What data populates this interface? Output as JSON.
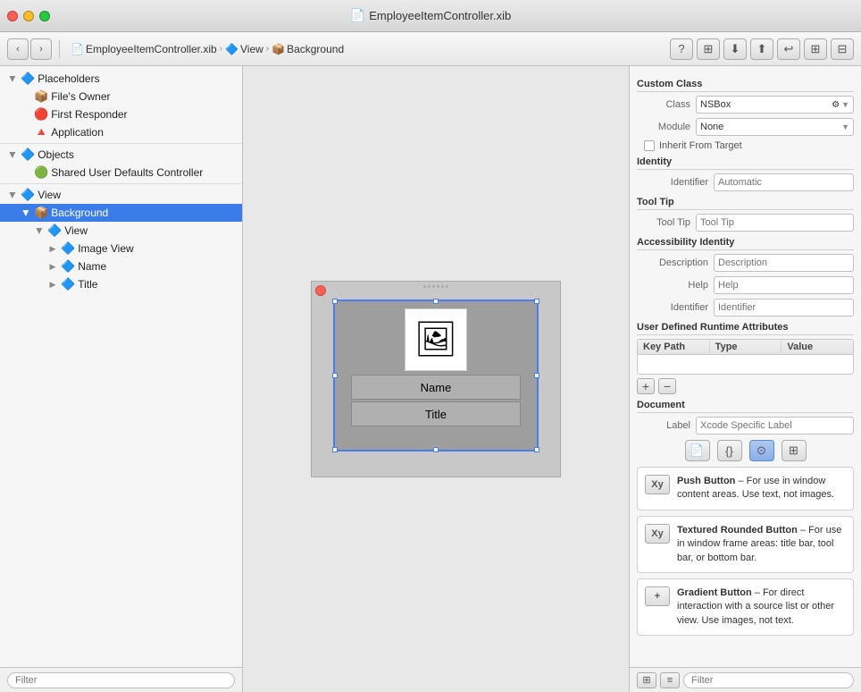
{
  "titleBar": {
    "title": "EmployeeItemController.xib",
    "icon": "📄"
  },
  "toolbar": {
    "backLabel": "‹",
    "forwardLabel": "›",
    "breadcrumbs": [
      {
        "icon": "📄",
        "label": "EmployeeItemController.xib"
      },
      {
        "icon": "🔷",
        "label": "View"
      },
      {
        "icon": "📦",
        "label": "Background"
      }
    ],
    "rightIcons": [
      "?",
      "⊞",
      "⬇",
      "⬆",
      "↩",
      "⊞",
      "⊟"
    ]
  },
  "leftPanel": {
    "sections": [
      {
        "name": "Placeholders",
        "icon": "🔷",
        "items": [
          {
            "label": "File's Owner",
            "icon": "📦",
            "indent": 1,
            "id": "files-owner"
          },
          {
            "label": "First Responder",
            "icon": "🔴",
            "indent": 1,
            "id": "first-responder"
          },
          {
            "label": "Application",
            "icon": "🔺",
            "indent": 1,
            "id": "application"
          }
        ]
      },
      {
        "name": "Objects",
        "icon": "🔷",
        "items": [
          {
            "label": "Shared User Defaults Controller",
            "icon": "🟢",
            "indent": 1,
            "id": "shared-user-defaults"
          }
        ]
      },
      {
        "name": "View",
        "icon": "🔷",
        "items": [
          {
            "label": "Background",
            "icon": "📦",
            "indent": 1,
            "id": "background",
            "selected": true
          },
          {
            "label": "View",
            "icon": "🔷",
            "indent": 2,
            "id": "view"
          },
          {
            "label": "Image View",
            "icon": "🔷",
            "indent": 3,
            "id": "image-view"
          },
          {
            "label": "Name",
            "icon": "🔷",
            "indent": 3,
            "id": "name"
          },
          {
            "label": "Title",
            "icon": "🔷",
            "indent": 3,
            "id": "title"
          }
        ]
      }
    ],
    "filterPlaceholder": "Filter"
  },
  "canvas": {
    "nameLabel": "Name",
    "titleLabel": "Title"
  },
  "rightPanel": {
    "customClass": {
      "title": "Custom Class",
      "classLabel": "Class",
      "classValue": "NSBox",
      "moduleLabel": "Module",
      "moduleValue": "None",
      "inheritLabel": "Inherit From Target"
    },
    "identity": {
      "title": "Identity",
      "identifierLabel": "Identifier",
      "identifierPlaceholder": "Automatic"
    },
    "toolTip": {
      "title": "Tool Tip",
      "tipLabel": "Tool Tip",
      "tipPlaceholder": "Tool Tip"
    },
    "accessibilityIdentity": {
      "title": "Accessibility Identity",
      "descriptionLabel": "Description",
      "descriptionPlaceholder": "Description",
      "helpLabel": "Help",
      "helpPlaceholder": "Help",
      "identifierLabel": "Identifier",
      "identifierPlaceholder": "Identifier"
    },
    "userDefinedRuntime": {
      "title": "User Defined Runtime Attributes",
      "columns": [
        "Key Path",
        "Type",
        "Value"
      ]
    },
    "document": {
      "title": "Document",
      "labelLabel": "Label",
      "labelPlaceholder": "Xcode Specific Label"
    },
    "objectLibrary": [
      {
        "icon": "Xy",
        "name": "Push Button",
        "desc": "Push Button – For use in window content areas. Use text, not images."
      },
      {
        "icon": "Xy",
        "name": "Textured Rounded Button",
        "desc": "Textured Rounded Button – For use in window frame areas: title bar, tool bar, or bottom bar."
      },
      {
        "icon": "+",
        "name": "Gradient Button",
        "desc": "Gradient Button – For direct interaction with a source list or other view. Use images, not text."
      }
    ],
    "filterPlaceholder": "Filter"
  }
}
